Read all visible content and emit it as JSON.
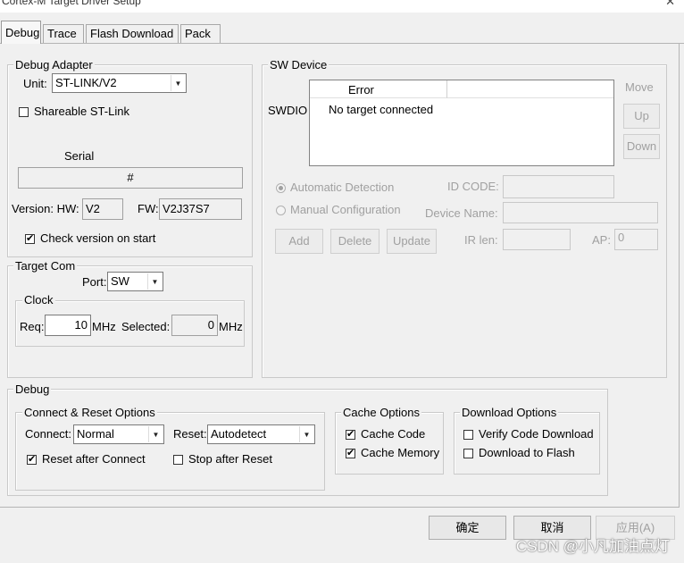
{
  "window": {
    "title": "Cortex-M Target Driver Setup",
    "close_glyph": "✕"
  },
  "tabs": [
    {
      "label": "Debug",
      "active": true
    },
    {
      "label": "Trace"
    },
    {
      "label": "Flash Download"
    },
    {
      "label": "Pack"
    }
  ],
  "debug_adapter": {
    "title": "Debug Adapter",
    "unit_label": "Unit:",
    "unit_value": "ST-LINK/V2",
    "shareable_label": "Shareable ST-Link",
    "shareable_checked": false,
    "serial_label": "Serial",
    "serial_value": "#",
    "version_label": "Version: HW:",
    "hw_value": "V2",
    "fw_label": "FW:",
    "fw_value": "V2J37S7",
    "check_version_label": "Check version on start",
    "check_version_checked": true
  },
  "target_com": {
    "title": "Target Com",
    "port_label": "Port:",
    "port_value": "SW",
    "clock": {
      "title": "Clock",
      "req_label": "Req:",
      "req_value": "10",
      "mhz1": "MHz",
      "selected_label": "Selected:",
      "selected_value": "0",
      "mhz2": "MHz"
    }
  },
  "sw_device": {
    "title": "SW Device",
    "move_label": "Move",
    "swdio_label": "SWDIO",
    "column_error": "Error",
    "row_text": "No target connected",
    "up_label": "Up",
    "down_label": "Down",
    "auto_detect_label": "Automatic Detection",
    "manual_config_label": "Manual Configuration",
    "id_code_label": "ID CODE:",
    "device_name_label": "Device Name:",
    "ir_len_label": "IR len:",
    "ap_label": "AP:",
    "ap_value": "0",
    "add_label": "Add",
    "delete_label": "Delete",
    "update_label": "Update"
  },
  "debug": {
    "title": "Debug",
    "connect_reset": {
      "title": "Connect & Reset Options",
      "connect_label": "Connect:",
      "connect_value": "Normal",
      "reset_label": "Reset:",
      "reset_value": "Autodetect",
      "reset_after_connect_label": "Reset after Connect",
      "reset_after_connect_checked": true,
      "stop_after_reset_label": "Stop after Reset",
      "stop_after_reset_checked": false
    },
    "cache": {
      "title": "Cache Options",
      "cache_code_label": "Cache Code",
      "cache_code_checked": true,
      "cache_memory_label": "Cache Memory",
      "cache_memory_checked": true
    },
    "download": {
      "title": "Download Options",
      "verify_label": "Verify Code Download",
      "verify_checked": false,
      "download_flash_label": "Download to Flash",
      "download_flash_checked": false
    }
  },
  "footer": {
    "ok_label": "确定",
    "cancel_label": "取消",
    "apply_label": "应用(A)"
  },
  "watermark": "CSDN @小凡加油点灯",
  "icons": {
    "check": "✔",
    "arrow": "▼"
  }
}
